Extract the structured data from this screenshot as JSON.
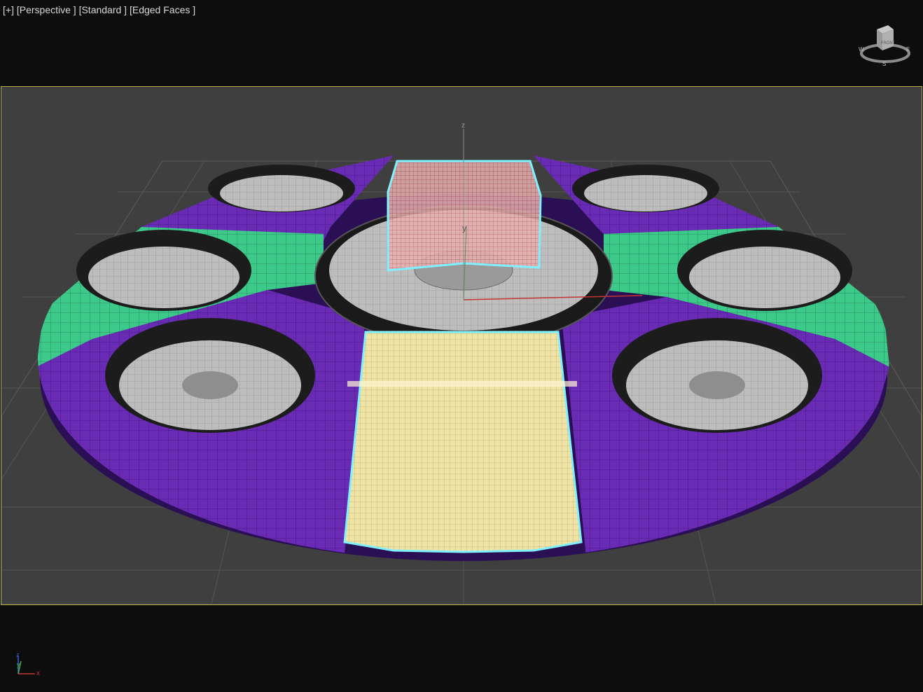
{
  "viewport": {
    "menu_plus": "[+]",
    "view_type": "[Perspective ]",
    "shading_mode": "[Standard ]",
    "display_mode": "[Edged Faces ]"
  },
  "viewcube": {
    "face_label": "FRONT",
    "compass": {
      "west": "W",
      "east": "E",
      "south": "S"
    }
  },
  "gizmo": {
    "z_label": "z",
    "y_label": "y"
  },
  "tripod": {
    "x_label": "x",
    "y_label": "y",
    "z_label": "z"
  },
  "colors": {
    "viewport_bg": "#3f3f3f",
    "outer_bg": "#0d0d0d",
    "frame_border": "#b3ad3a",
    "purple_panel": "#6a2bb4",
    "green_panel": "#3cc98a",
    "yellow_panel": "#efe3a6",
    "red_panel": "#e5a6a6",
    "selection": "#7ff0ff",
    "hub_gray": "#b8b8b8"
  }
}
